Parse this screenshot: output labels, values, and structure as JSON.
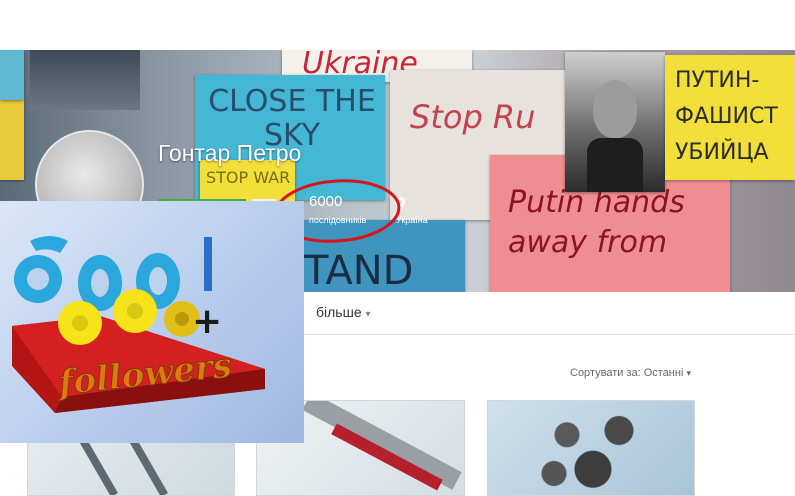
{
  "profile": {
    "name": "Гонтар Петро",
    "followers_count": "6000",
    "followers_label": "послідовників",
    "location": "Україна"
  },
  "tabs": {
    "more_label": "більше"
  },
  "sort": {
    "label": "Сортувати за: Останні"
  },
  "cover_posters": {
    "ukraine": "Ukraine",
    "close_sky": "CLOSE THE SKY",
    "stop_war": "STOP WAR",
    "stop_ru": "Stop Ru",
    "putin_fascist": "ПУТИН-ФАШИСТ УБИЙЦА",
    "putin_hands": "Putin hands away from",
    "stand": "TAND"
  },
  "overlay_badge": {
    "number_text": "600",
    "plus": "+",
    "word": "followers"
  },
  "colors": {
    "annotation_red": "#d6151f",
    "poster_yellow": "#f2df3a",
    "poster_red": "#c9243a",
    "poster_cyan": "#39b8d6"
  }
}
